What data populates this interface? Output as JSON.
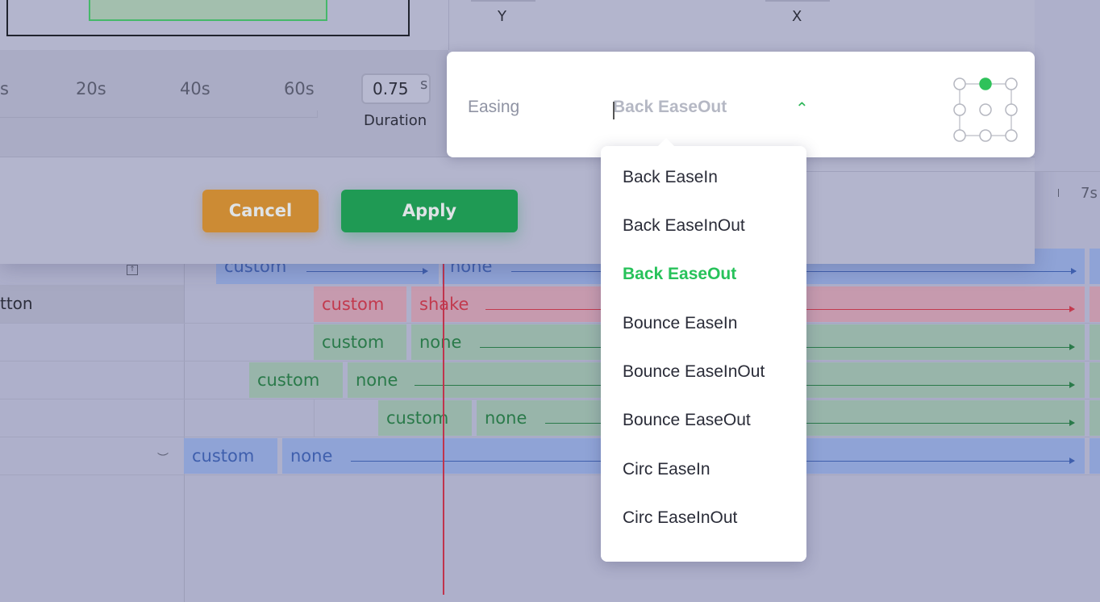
{
  "dialog": {
    "ruler_ticks": [
      "s",
      "20s",
      "40s",
      "60s"
    ],
    "duration": {
      "value": "0.75",
      "unit": "s",
      "label": "Duration"
    },
    "axes": {
      "y_label": "Y",
      "x_label": "X"
    },
    "buttons": {
      "cancel": "Cancel",
      "apply": "Apply"
    }
  },
  "easing": {
    "label": "Easing",
    "value": "Back EaseOut",
    "options": [
      {
        "label": "Back EaseIn",
        "selected": false
      },
      {
        "label": "Back EaseInOut",
        "selected": false
      },
      {
        "label": "Back EaseOut",
        "selected": true
      },
      {
        "label": "Bounce EaseIn",
        "selected": false
      },
      {
        "label": "Bounce EaseInOut",
        "selected": false
      },
      {
        "label": "Bounce EaseOut",
        "selected": false
      },
      {
        "label": "Circ EaseIn",
        "selected": false
      },
      {
        "label": "Circ EaseInOut",
        "selected": false
      }
    ]
  },
  "timeline": {
    "header_tick": "7s",
    "row_label": "tton",
    "rows": [
      {
        "color": "blue",
        "first": "custom",
        "second": "none"
      },
      {
        "color": "red",
        "first": "custom",
        "second": "shake"
      },
      {
        "color": "green",
        "first": "custom",
        "second": "none"
      },
      {
        "color": "green",
        "first": "custom",
        "second": "none"
      },
      {
        "color": "green",
        "first": "custom",
        "second": "none"
      },
      {
        "color": "blue",
        "first": "custom",
        "second": "none"
      }
    ]
  },
  "colors": {
    "accent_green": "#27c25a",
    "apply": "#1f9a54",
    "cancel": "#cc8b34",
    "playhead": "#c0344d"
  }
}
